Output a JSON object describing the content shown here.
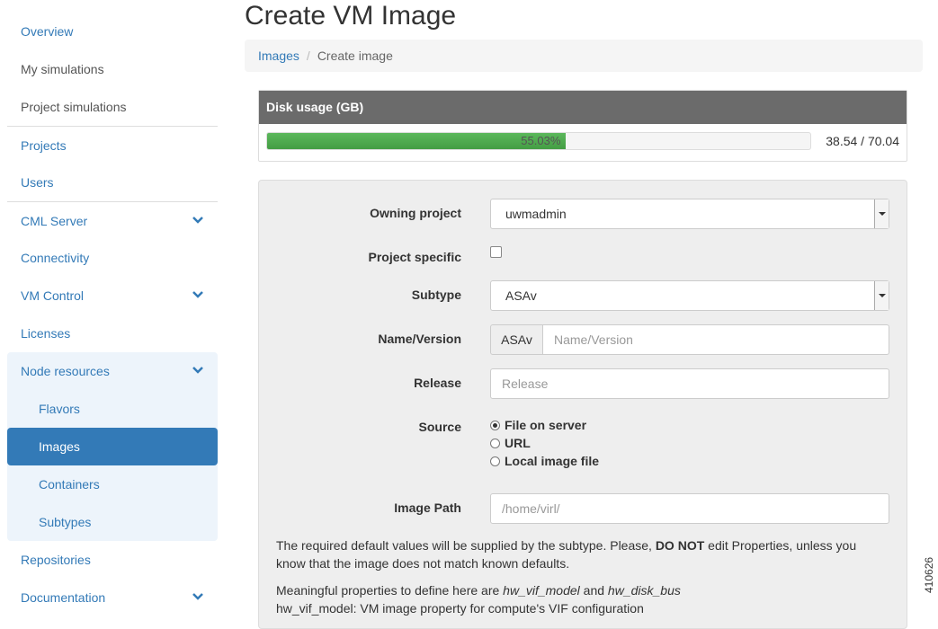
{
  "sidebar": {
    "items": [
      {
        "label": "Overview"
      },
      {
        "label": "My simulations"
      },
      {
        "label": "Project simulations"
      },
      {
        "label": "Projects"
      },
      {
        "label": "Users"
      },
      {
        "label": "CML Server"
      },
      {
        "label": "Connectivity"
      },
      {
        "label": "VM Control"
      },
      {
        "label": "Licenses"
      },
      {
        "label": "Node resources"
      },
      {
        "label": "Flavors"
      },
      {
        "label": "Images"
      },
      {
        "label": "Containers"
      },
      {
        "label": "Subtypes"
      },
      {
        "label": "Repositories"
      },
      {
        "label": "Documentation"
      }
    ]
  },
  "page": {
    "title": "Create VM Image"
  },
  "breadcrumb": {
    "link": "Images",
    "separator": "/",
    "current": "Create image"
  },
  "disk": {
    "header": "Disk usage (GB)",
    "percent_label": "55.03%",
    "percent": 55.03,
    "values": "38.54 / 70.04"
  },
  "form": {
    "owning_project": {
      "label": "Owning project",
      "value": "uwmadmin"
    },
    "project_specific": {
      "label": "Project specific",
      "checked": false
    },
    "subtype": {
      "label": "Subtype",
      "value": "ASAv"
    },
    "name_version": {
      "label": "Name/Version",
      "addon": "ASAv",
      "placeholder": "Name/Version"
    },
    "release": {
      "label": "Release",
      "placeholder": "Release"
    },
    "source": {
      "label": "Source",
      "options": [
        "File on server",
        "URL",
        "Local image file"
      ],
      "selected": "File on server"
    },
    "image_path": {
      "label": "Image Path",
      "placeholder": "/home/virl/"
    },
    "help1": {
      "pre": "The required default values will be supplied by the subtype. Please, ",
      "bold": "DO NOT",
      "post": " edit Properties, unless you know that the image does not match known defaults."
    },
    "help2": {
      "pre": "Meaningful properties to define here are ",
      "em1": "hw_vif_model",
      "mid": " and ",
      "em2": "hw_disk_bus"
    },
    "help3": "hw_vif_model: VM image property for compute's VIF configuration"
  },
  "figure_code": "410626",
  "colors": {
    "accent": "#337ab7",
    "progress": "#5cb85c",
    "panel_header": "#6b6b6b"
  }
}
